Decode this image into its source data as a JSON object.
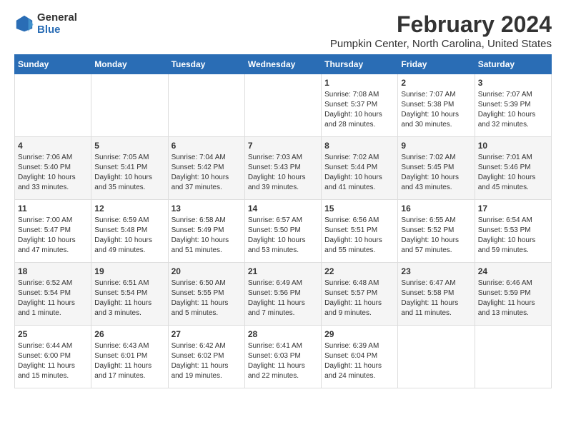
{
  "logo": {
    "line1": "General",
    "line2": "Blue"
  },
  "title": "February 2024",
  "subtitle": "Pumpkin Center, North Carolina, United States",
  "headers": [
    "Sunday",
    "Monday",
    "Tuesday",
    "Wednesday",
    "Thursday",
    "Friday",
    "Saturday"
  ],
  "weeks": [
    [
      {
        "day": "",
        "info": ""
      },
      {
        "day": "",
        "info": ""
      },
      {
        "day": "",
        "info": ""
      },
      {
        "day": "",
        "info": ""
      },
      {
        "day": "1",
        "info": "Sunrise: 7:08 AM\nSunset: 5:37 PM\nDaylight: 10 hours\nand 28 minutes."
      },
      {
        "day": "2",
        "info": "Sunrise: 7:07 AM\nSunset: 5:38 PM\nDaylight: 10 hours\nand 30 minutes."
      },
      {
        "day": "3",
        "info": "Sunrise: 7:07 AM\nSunset: 5:39 PM\nDaylight: 10 hours\nand 32 minutes."
      }
    ],
    [
      {
        "day": "4",
        "info": "Sunrise: 7:06 AM\nSunset: 5:40 PM\nDaylight: 10 hours\nand 33 minutes."
      },
      {
        "day": "5",
        "info": "Sunrise: 7:05 AM\nSunset: 5:41 PM\nDaylight: 10 hours\nand 35 minutes."
      },
      {
        "day": "6",
        "info": "Sunrise: 7:04 AM\nSunset: 5:42 PM\nDaylight: 10 hours\nand 37 minutes."
      },
      {
        "day": "7",
        "info": "Sunrise: 7:03 AM\nSunset: 5:43 PM\nDaylight: 10 hours\nand 39 minutes."
      },
      {
        "day": "8",
        "info": "Sunrise: 7:02 AM\nSunset: 5:44 PM\nDaylight: 10 hours\nand 41 minutes."
      },
      {
        "day": "9",
        "info": "Sunrise: 7:02 AM\nSunset: 5:45 PM\nDaylight: 10 hours\nand 43 minutes."
      },
      {
        "day": "10",
        "info": "Sunrise: 7:01 AM\nSunset: 5:46 PM\nDaylight: 10 hours\nand 45 minutes."
      }
    ],
    [
      {
        "day": "11",
        "info": "Sunrise: 7:00 AM\nSunset: 5:47 PM\nDaylight: 10 hours\nand 47 minutes."
      },
      {
        "day": "12",
        "info": "Sunrise: 6:59 AM\nSunset: 5:48 PM\nDaylight: 10 hours\nand 49 minutes."
      },
      {
        "day": "13",
        "info": "Sunrise: 6:58 AM\nSunset: 5:49 PM\nDaylight: 10 hours\nand 51 minutes."
      },
      {
        "day": "14",
        "info": "Sunrise: 6:57 AM\nSunset: 5:50 PM\nDaylight: 10 hours\nand 53 minutes."
      },
      {
        "day": "15",
        "info": "Sunrise: 6:56 AM\nSunset: 5:51 PM\nDaylight: 10 hours\nand 55 minutes."
      },
      {
        "day": "16",
        "info": "Sunrise: 6:55 AM\nSunset: 5:52 PM\nDaylight: 10 hours\nand 57 minutes."
      },
      {
        "day": "17",
        "info": "Sunrise: 6:54 AM\nSunset: 5:53 PM\nDaylight: 10 hours\nand 59 minutes."
      }
    ],
    [
      {
        "day": "18",
        "info": "Sunrise: 6:52 AM\nSunset: 5:54 PM\nDaylight: 11 hours\nand 1 minute."
      },
      {
        "day": "19",
        "info": "Sunrise: 6:51 AM\nSunset: 5:54 PM\nDaylight: 11 hours\nand 3 minutes."
      },
      {
        "day": "20",
        "info": "Sunrise: 6:50 AM\nSunset: 5:55 PM\nDaylight: 11 hours\nand 5 minutes."
      },
      {
        "day": "21",
        "info": "Sunrise: 6:49 AM\nSunset: 5:56 PM\nDaylight: 11 hours\nand 7 minutes."
      },
      {
        "day": "22",
        "info": "Sunrise: 6:48 AM\nSunset: 5:57 PM\nDaylight: 11 hours\nand 9 minutes."
      },
      {
        "day": "23",
        "info": "Sunrise: 6:47 AM\nSunset: 5:58 PM\nDaylight: 11 hours\nand 11 minutes."
      },
      {
        "day": "24",
        "info": "Sunrise: 6:46 AM\nSunset: 5:59 PM\nDaylight: 11 hours\nand 13 minutes."
      }
    ],
    [
      {
        "day": "25",
        "info": "Sunrise: 6:44 AM\nSunset: 6:00 PM\nDaylight: 11 hours\nand 15 minutes."
      },
      {
        "day": "26",
        "info": "Sunrise: 6:43 AM\nSunset: 6:01 PM\nDaylight: 11 hours\nand 17 minutes."
      },
      {
        "day": "27",
        "info": "Sunrise: 6:42 AM\nSunset: 6:02 PM\nDaylight: 11 hours\nand 19 minutes."
      },
      {
        "day": "28",
        "info": "Sunrise: 6:41 AM\nSunset: 6:03 PM\nDaylight: 11 hours\nand 22 minutes."
      },
      {
        "day": "29",
        "info": "Sunrise: 6:39 AM\nSunset: 6:04 PM\nDaylight: 11 hours\nand 24 minutes."
      },
      {
        "day": "",
        "info": ""
      },
      {
        "day": "",
        "info": ""
      }
    ]
  ]
}
